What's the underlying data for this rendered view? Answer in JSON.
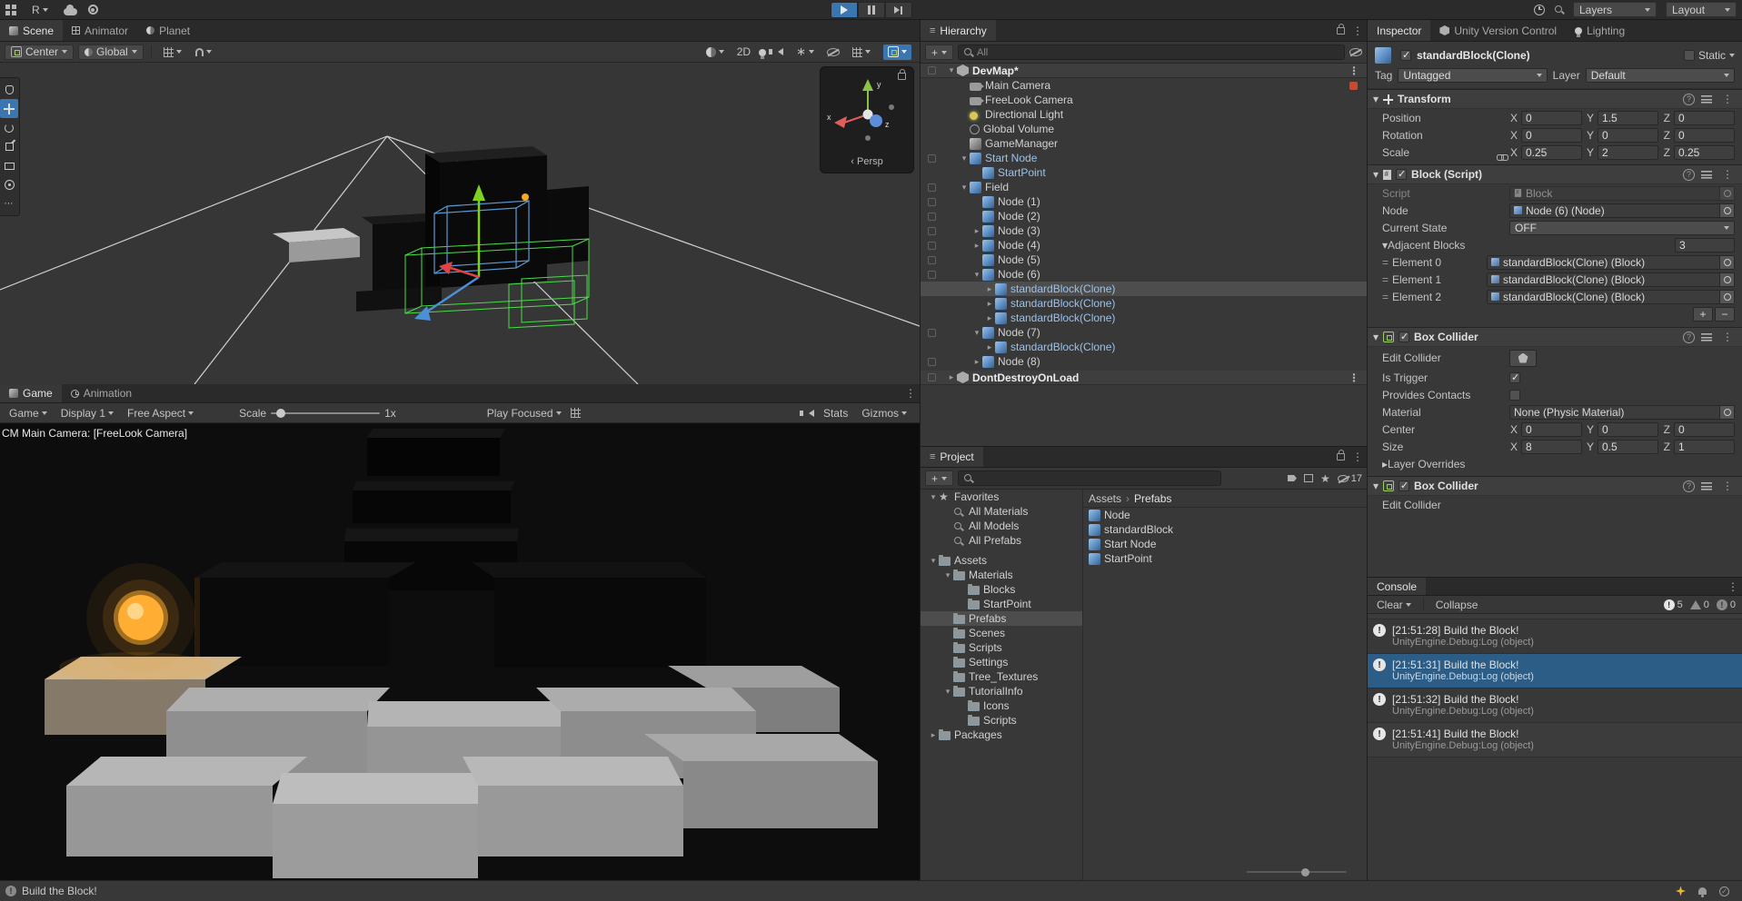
{
  "colors": {
    "accent-blue": "#3C76B0",
    "selection-blue": "#2C5D87",
    "selected-gray": "#4D4D4D",
    "warn-yellow": "#E8B931",
    "orb-orange": "#F5A623"
  },
  "icons": {
    "search": "css-circle-with-tail",
    "gear": "css-ring-dot",
    "cloud": "css-blob",
    "kebab-menu": "U+22EE",
    "expand-open": "U+25BE",
    "expand-closed": "U+25B8",
    "favorites-star": "U+2605",
    "checkmark": "U+2713",
    "info-log": "css-white-circle-exclamation",
    "warning-log": "css-triangle",
    "folder": "css-folder-shape",
    "prefab-cube": "css-blue-gradient-cube"
  },
  "top_toolbar": {
    "account": "R",
    "layers": "Layers",
    "layout": "Layout"
  },
  "scene": {
    "tabs": [
      "Scene",
      "Animator",
      "Planet"
    ],
    "pivot": "Center",
    "orientation": "Global",
    "mode_2d": "2D",
    "gizmo": {
      "x": "x",
      "y": "y",
      "z": "z",
      "persp": "Persp"
    }
  },
  "game": {
    "tabs": [
      "Game",
      "Animation"
    ],
    "mode": "Game",
    "display": "Display 1",
    "aspect": "Free Aspect",
    "scale_label": "Scale",
    "scale_value": "1x",
    "focus": "Play Focused",
    "stats": "Stats",
    "gizmos": "Gizmos",
    "overlay": "CM Main Camera: [FreeLook Camera]"
  },
  "hierarchy": {
    "title": "Hierarchy",
    "search_placeholder": "All",
    "rows": [
      {
        "label": "DevMap*"
      },
      {
        "label": "Main Camera"
      },
      {
        "label": "FreeLook Camera"
      },
      {
        "label": "Directional Light"
      },
      {
        "label": "Global Volume"
      },
      {
        "label": "GameManager"
      },
      {
        "label": "Start Node"
      },
      {
        "label": "StartPoint"
      },
      {
        "label": "Field"
      },
      {
        "label": "Node (1)"
      },
      {
        "label": "Node (2)"
      },
      {
        "label": "Node (3)"
      },
      {
        "label": "Node (4)"
      },
      {
        "label": "Node (5)"
      },
      {
        "label": "Node (6)"
      },
      {
        "label": "standardBlock(Clone)"
      },
      {
        "label": "standardBlock(Clone)"
      },
      {
        "label": "standardBlock(Clone)"
      },
      {
        "label": "Node (7)"
      },
      {
        "label": "standardBlock(Clone)"
      },
      {
        "label": "Node (8)"
      },
      {
        "label": "DontDestroyOnLoad"
      }
    ]
  },
  "project": {
    "title": "Project",
    "hidden_count": "17",
    "tree": [
      {
        "label": "Favorites"
      },
      {
        "label": "All Materials"
      },
      {
        "label": "All Models"
      },
      {
        "label": "All Prefabs"
      },
      {
        "label": "Assets"
      },
      {
        "label": "Materials"
      },
      {
        "label": "Blocks"
      },
      {
        "label": "StartPoint"
      },
      {
        "label": "Prefabs"
      },
      {
        "label": "Scenes"
      },
      {
        "label": "Scripts"
      },
      {
        "label": "Settings"
      },
      {
        "label": "Tree_Textures"
      },
      {
        "label": "TutorialInfo"
      },
      {
        "label": "Icons"
      },
      {
        "label": "Scripts"
      },
      {
        "label": "Packages"
      }
    ],
    "breadcrumb": {
      "root": "Assets",
      "sep": "›",
      "current": "Prefabs"
    },
    "files": [
      {
        "label": "Node"
      },
      {
        "label": "standardBlock"
      },
      {
        "label": "Start Node"
      },
      {
        "label": "StartPoint"
      }
    ]
  },
  "inspector": {
    "tabs": [
      "Inspector",
      "Unity Version Control",
      "Lighting"
    ],
    "name": "standardBlock(Clone)",
    "static_label": "Static",
    "tag_label": "Tag",
    "tag": "Untagged",
    "layer_label": "Layer",
    "layer": "Default",
    "axis": {
      "x": "X",
      "y": "Y",
      "z": "Z"
    },
    "transform": {
      "title": "Transform",
      "rows": [
        {
          "label": "Position",
          "x": "0",
          "y": "1.5",
          "z": "0"
        },
        {
          "label": "Rotation",
          "x": "0",
          "y": "0",
          "z": "0"
        },
        {
          "label": "Scale",
          "x": "0.25",
          "y": "2",
          "z": "0.25"
        }
      ]
    },
    "block": {
      "title": "Block (Script)",
      "script_label": "Script",
      "script_value": "Block",
      "node_label": "Node",
      "node_value": "Node (6) (Node)",
      "state_label": "Current State",
      "state_value": "OFF",
      "adjacent_label": "Adjacent Blocks",
      "size": "3",
      "elements": [
        {
          "label": "Element 0",
          "value": "standardBlock(Clone) (Block)"
        },
        {
          "label": "Element 1",
          "value": "standardBlock(Clone) (Block)"
        },
        {
          "label": "Element 2",
          "value": "standardBlock(Clone) (Block)"
        }
      ],
      "add": "+",
      "remove": "−"
    },
    "collider": {
      "title": "Box Collider",
      "edit_label": "Edit Collider",
      "is_trigger": "Is Trigger",
      "provides_contacts": "Provides Contacts",
      "material_label": "Material",
      "material_value": "None (Physic Material)",
      "center_label": "Center",
      "center": {
        "x": "0",
        "y": "0",
        "z": "0"
      },
      "size_label": "Size",
      "size": {
        "x": "8",
        "y": "0.5",
        "z": "1"
      },
      "layer_overrides": "Layer Overrides"
    },
    "collider2": {
      "title": "Box Collider",
      "edit_label": "Edit Collider"
    }
  },
  "console": {
    "title": "Console",
    "clear": "Clear",
    "collapse": "Collapse",
    "counts": {
      "info": "5",
      "warn": "0",
      "error": "0"
    },
    "entries": [
      {
        "time": "[21:51:28]",
        "message": "Build the Block!",
        "detail": "UnityEngine.Debug:Log (object)"
      },
      {
        "time": "[21:51:31]",
        "message": "Build the Block!",
        "detail": "UnityEngine.Debug:Log (object)"
      },
      {
        "time": "[21:51:32]",
        "message": "Build the Block!",
        "detail": "UnityEngine.Debug:Log (object)"
      },
      {
        "time": "[21:51:41]",
        "message": "Build the Block!",
        "detail": "UnityEngine.Debug:Log (object)"
      }
    ]
  },
  "status": {
    "message": "Build the Block!"
  }
}
